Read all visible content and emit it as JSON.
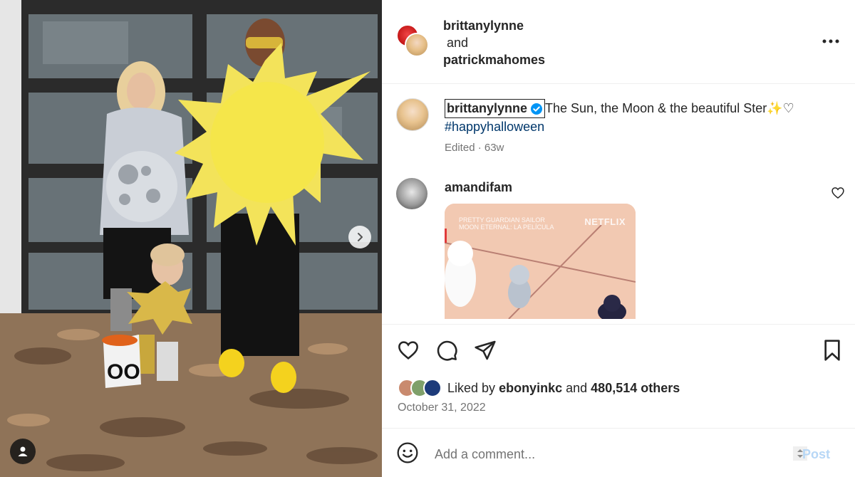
{
  "header": {
    "user1": "brittanylynne",
    "joiner": "and",
    "user2": "patrickmahomes"
  },
  "caption": {
    "username": "brittanylynne",
    "text": "The Sun, the Moon & the beautiful Ster✨♡",
    "hashtag": "#happyhalloween",
    "meta": "Edited · 63w"
  },
  "comment": {
    "username": "amandifam",
    "gif_label_line1": "PRETTY GUARDIAN SAILOR",
    "gif_label_line2": "MOON ETERNAL: LA PELÍCULA",
    "gif_logo": "NETFLIX"
  },
  "likes": {
    "prefix": "Liked by",
    "user": "ebonyinkc",
    "joiner": "and",
    "others": "480,514 others"
  },
  "date": "October 31, 2022",
  "comment_box": {
    "placeholder": "Add a comment...",
    "post_label": "Post"
  },
  "icons": {
    "more": "more-options-icon",
    "like": "heart-icon",
    "comment": "comment-icon",
    "share": "share-icon",
    "save": "bookmark-icon",
    "emoji": "emoji-icon",
    "next": "chevron-right-icon",
    "tag": "user-tag-icon"
  },
  "colors": {
    "hashtag": "#00376b",
    "verified": "#0095f6",
    "post_disabled": "#b7d7f6",
    "meta": "#737373"
  }
}
